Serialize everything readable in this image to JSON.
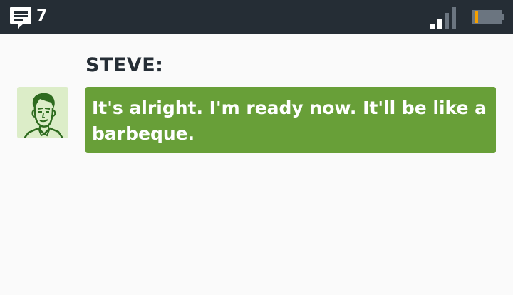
{
  "status_bar": {
    "message_count": "7",
    "icons": [
      "chat-bubble-icon",
      "signal-strength-icon",
      "battery-low-icon"
    ],
    "battery_level": 0.15,
    "signal_bars_lit": 2,
    "signal_bars_total": 4
  },
  "dialog": {
    "speaker": "STEVE:",
    "message": "It's alright. I'm ready now. It'll be like a barbeque."
  },
  "colors": {
    "status_bar_bg": "#252d35",
    "background": "#fafafa",
    "bubble_bg": "#689f38",
    "avatar_bg": "#dcedc8",
    "avatar_ink": "#2e6b1f",
    "battery_fill": "#f5a000"
  }
}
